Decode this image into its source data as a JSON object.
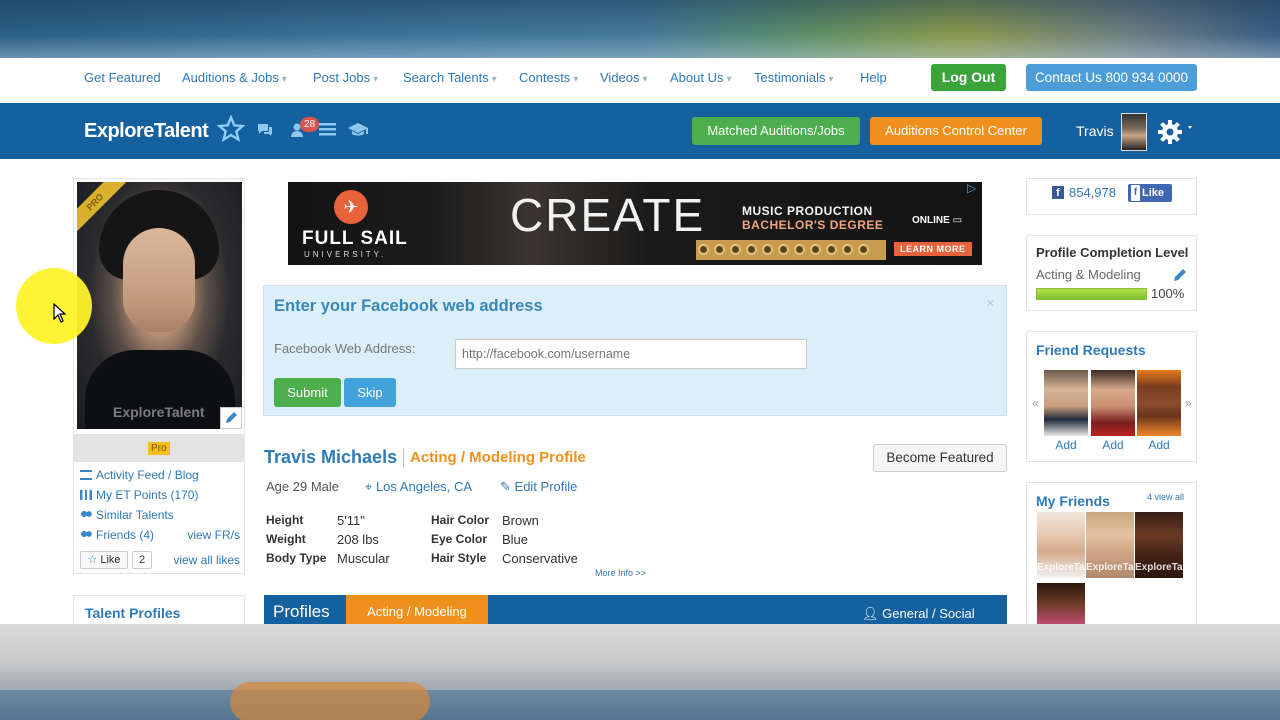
{
  "nav": {
    "items": [
      {
        "label": "Get Featured",
        "caret": false
      },
      {
        "label": "Auditions & Jobs",
        "caret": true
      },
      {
        "label": "Post Jobs",
        "caret": true
      },
      {
        "label": "Search Talents",
        "caret": true
      },
      {
        "label": "Contests",
        "caret": true
      },
      {
        "label": "Videos",
        "caret": true
      },
      {
        "label": "About Us",
        "caret": true
      },
      {
        "label": "Testimonials",
        "caret": true
      },
      {
        "label": "Help",
        "caret": false
      }
    ],
    "logout_label": "Log Out",
    "contact_label": "Contact Us 800 934 0000"
  },
  "header": {
    "logo_text": "ExploreTalent",
    "notification_count": "28",
    "matched_label": "Matched Auditions/Jobs",
    "auditions_label": "Auditions Control Center",
    "username": "Travis"
  },
  "left": {
    "pro_ribbon": "PRO",
    "photo_watermark": "ExploreTalent",
    "pro_tag": "Pro",
    "links": {
      "activity": "Activity Feed / Blog",
      "points": "My ET Points (170)",
      "similar": "Similar Talents",
      "friends": "Friends (4)",
      "view_fr": "view FR/s"
    },
    "like_label": "Like",
    "like_count": "2",
    "view_all_likes": "view all likes",
    "talent_profiles_title": "Talent Profiles"
  },
  "ad": {
    "brand": "FULL SAIL",
    "brand_sub": "UNIVERSITY.",
    "headline": "CREATE",
    "line1": "MUSIC PRODUCTION",
    "line2": "BACHELOR'S DEGREE",
    "online": "ONLINE",
    "cta": "LEARN MORE"
  },
  "facebook_prompt": {
    "title": "Enter your Facebook web address",
    "field_label": "Facebook Web Address:",
    "placeholder": "http://facebook.com/username",
    "submit_label": "Submit",
    "skip_label": "Skip",
    "close": "×"
  },
  "profile": {
    "name": "Travis Michaels",
    "type": "Acting / Modeling Profile",
    "become_featured": "Become Featured",
    "age_gender": "Age 29 Male",
    "location": "Los Angeles, CA",
    "edit_label": "Edit Profile",
    "attributes_left": [
      {
        "key": "Height",
        "value": "5'11\""
      },
      {
        "key": "Weight",
        "value": "208 lbs"
      },
      {
        "key": "Body Type",
        "value": "Muscular"
      }
    ],
    "attributes_right": [
      {
        "key": "Hair Color",
        "value": "Brown"
      },
      {
        "key": "Eye Color",
        "value": "Blue"
      },
      {
        "key": "Hair Style",
        "value": "Conservative"
      }
    ],
    "more_info": "More Info >>",
    "tabs": {
      "profiles": "Profiles",
      "acting": "Acting / Modeling",
      "general": "General / Social"
    }
  },
  "right": {
    "fb_count": "854,978",
    "fb_like": "Like",
    "completion": {
      "title": "Profile Completion Level",
      "category": "Acting & Modeling",
      "percent_label": "100%",
      "fraction": 1.0
    },
    "friend_requests": {
      "title": "Friend Requests",
      "add_label": "Add",
      "prev": "«",
      "next": "»"
    },
    "my_friends": {
      "title": "My Friends",
      "view_all": "4 view all",
      "watermark": "ExploreTalent"
    }
  },
  "colors": {
    "brand_blue": "#15609f",
    "link_blue": "#2f7ab8",
    "green": "#4cae4c",
    "orange": "#f0901c"
  }
}
